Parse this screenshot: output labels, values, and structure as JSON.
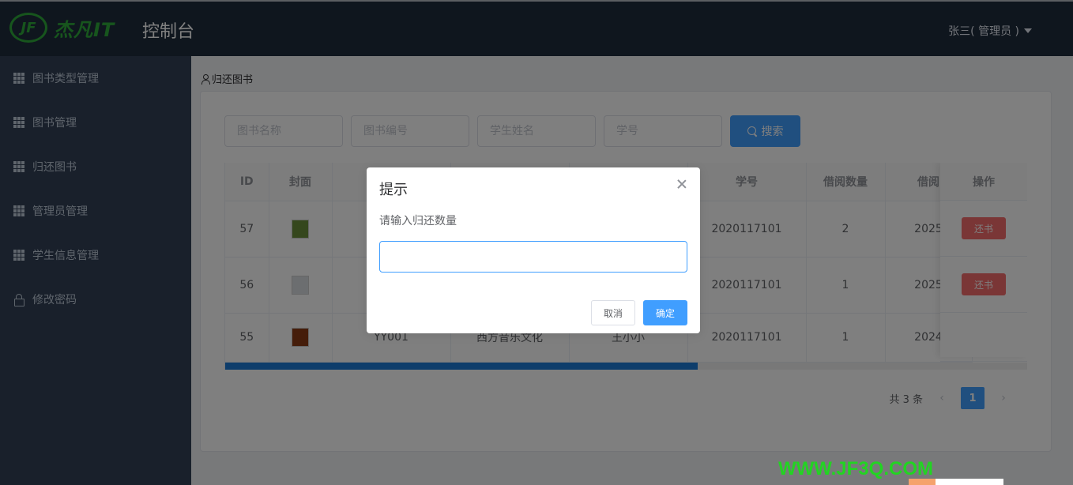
{
  "header": {
    "logo_mark": "JF",
    "logo_text": "杰凡IT",
    "title": "控制台",
    "user": "张三( 管理员 )"
  },
  "sidebar": {
    "items": [
      {
        "label": "图书类型管理",
        "icon": "grid-icon"
      },
      {
        "label": "图书管理",
        "icon": "grid-icon"
      },
      {
        "label": "归还图书",
        "icon": "grid-icon"
      },
      {
        "label": "管理员管理",
        "icon": "grid-icon"
      },
      {
        "label": "学生信息管理",
        "icon": "grid-icon"
      },
      {
        "label": "修改密码",
        "icon": "lock-icon"
      }
    ]
  },
  "breadcrumb": "归还图书",
  "filters": {
    "book_name_placeholder": "图书名称",
    "book_no_placeholder": "图书编号",
    "student_name_placeholder": "学生姓名",
    "student_no_placeholder": "学号",
    "search_label": "搜索"
  },
  "table": {
    "headers": [
      "ID",
      "封面",
      "",
      "",
      "",
      "学号",
      "借阅数量",
      "借阅"
    ],
    "action_header": "操作",
    "rows": [
      {
        "id": "57",
        "code": "",
        "name": "",
        "student": "",
        "student_no": "2020117101",
        "qty": "2",
        "date": "2025",
        "cover_color": "#6b8f3a"
      },
      {
        "id": "56",
        "code": "",
        "name": "",
        "student": "",
        "student_no": "2020117101",
        "qty": "1",
        "date": "2025",
        "cover_color": "#d9dde0"
      },
      {
        "id": "55",
        "code": "YY001",
        "name": "西方音乐文化",
        "student": "王小小",
        "student_no": "2020117101",
        "qty": "1",
        "date": "2024",
        "cover_color": "#8a3a14"
      }
    ],
    "return_label": "还书"
  },
  "pagination": {
    "total": "共 3 条",
    "current": "1"
  },
  "dialog": {
    "title": "提示",
    "message": "请输入归还数量",
    "input_value": "",
    "cancel_label": "取消",
    "ok_label": "确定"
  },
  "watermark": "WWW.JF3Q.COM",
  "colors": {
    "header_bg": "#1f2d3d",
    "sidebar_bg": "#324157",
    "primary": "#409eff",
    "danger": "#f56c6c",
    "logo": "#2eaa3a"
  }
}
